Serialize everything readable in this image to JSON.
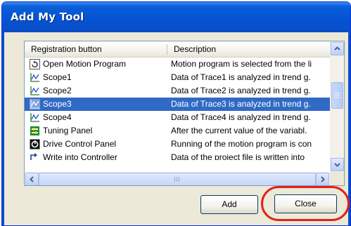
{
  "window": {
    "title": "Add My Tool"
  },
  "list": {
    "columns": [
      "Registration button",
      "Description"
    ],
    "rows": [
      {
        "name": "Open Motion Program",
        "desc": "Motion program is selected from the li",
        "icon": "open-motion-program-icon",
        "selected": false
      },
      {
        "name": "Scope1",
        "desc": "Data of Trace1 is analyzed in trend g.",
        "icon": "scope-icon",
        "selected": false
      },
      {
        "name": "Scope2",
        "desc": "Data of Trace2 is analyzed in trend g.",
        "icon": "scope-icon",
        "selected": false
      },
      {
        "name": "Scope3",
        "desc": "Data of Trace3 is analyzed in trend g.",
        "icon": "scope-icon",
        "selected": true
      },
      {
        "name": "Scope4",
        "desc": "Data of Trace4 is analyzed in trend g.",
        "icon": "scope-icon",
        "selected": false
      },
      {
        "name": "Tuning Panel",
        "desc": "After the current value of the variabl.",
        "icon": "tuning-panel-icon",
        "selected": false
      },
      {
        "name": "Drive Control Panel",
        "desc": "Running of the motion program is con",
        "icon": "drive-control-panel-icon",
        "selected": false
      },
      {
        "name": "Write into Controller",
        "desc": "Data of the project file is written into",
        "icon": "write-controller-icon",
        "selected": false
      }
    ]
  },
  "buttons": {
    "add": "Add",
    "close": "Close"
  },
  "colors": {
    "titlebar": "#0453d4",
    "selection": "#316ac5",
    "highlight": "#e2201c",
    "dialog_bg": "#ece9d8"
  }
}
